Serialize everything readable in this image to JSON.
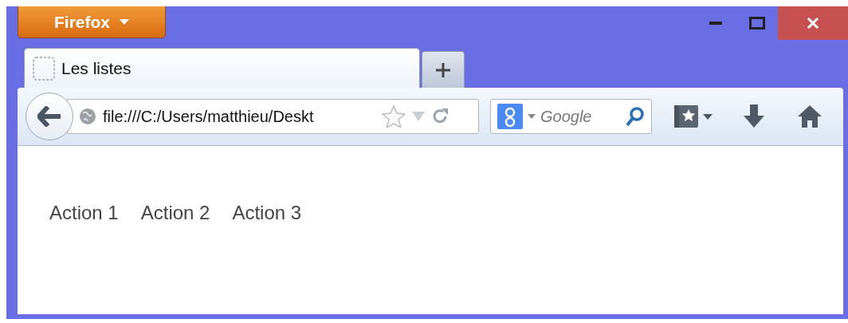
{
  "menu_button": {
    "label": "Firefox"
  },
  "tabs": [
    {
      "label": "Les listes",
      "selected": true
    }
  ],
  "address_bar": {
    "value": "file:///C:/Users/matthieu/Deskt"
  },
  "search": {
    "placeholder": "Google"
  },
  "content": {
    "items": [
      "Action 1",
      "Action 2",
      "Action 3"
    ]
  }
}
